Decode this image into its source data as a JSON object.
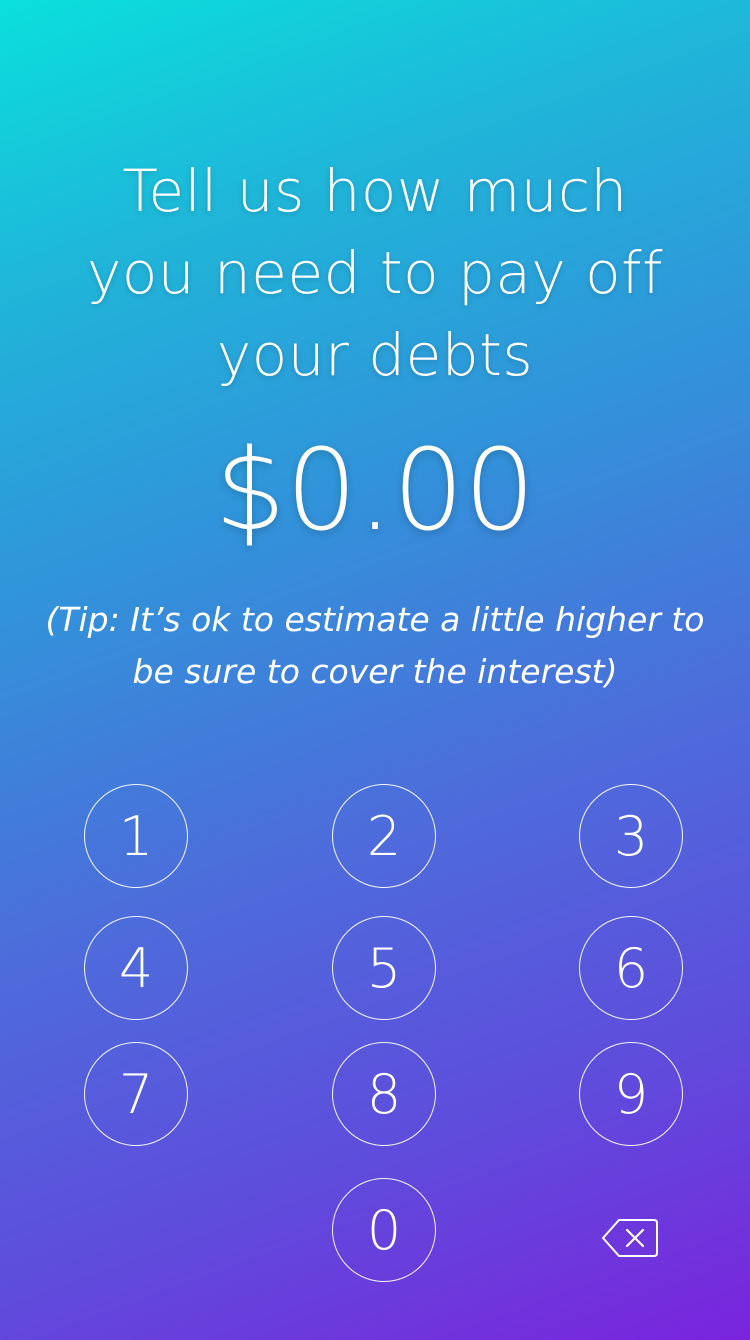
{
  "prompt": {
    "line1": "Tell us how much",
    "line2": "you need to pay off",
    "line3": "your debts"
  },
  "amount": "$0.00",
  "tip": {
    "line1": "(Tip: It’s ok to estimate a little higher to",
    "line2": "be sure to cover the interest)"
  },
  "keypad": {
    "k1": "1",
    "k2": "2",
    "k3": "3",
    "k4": "4",
    "k5": "5",
    "k6": "6",
    "k7": "7",
    "k8": "8",
    "k9": "9",
    "k0": "0",
    "backspace_icon": "backspace-icon"
  }
}
